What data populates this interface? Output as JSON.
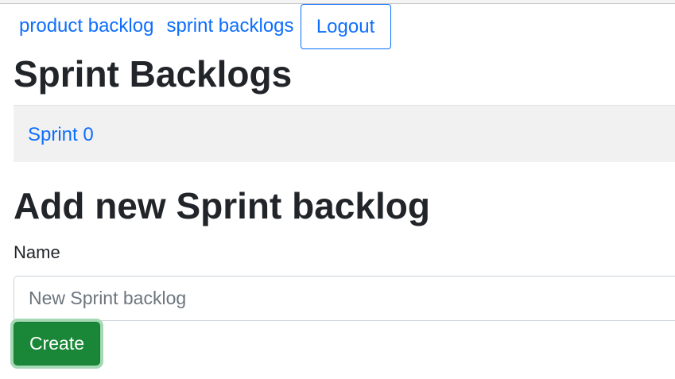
{
  "nav": {
    "product_backlog": "product backlog",
    "sprint_backlogs": "sprint backlogs",
    "logout": "Logout"
  },
  "page_title": "Sprint Backlogs",
  "sprints": [
    {
      "name": "Sprint 0"
    }
  ],
  "form": {
    "title": "Add new Sprint backlog",
    "name_label": "Name",
    "name_value": "",
    "name_placeholder": "New Sprint backlog",
    "create_label": "Create"
  },
  "colors": {
    "link": "#0d6efd",
    "success": "#198737",
    "list_background": "#f1f1f1"
  }
}
